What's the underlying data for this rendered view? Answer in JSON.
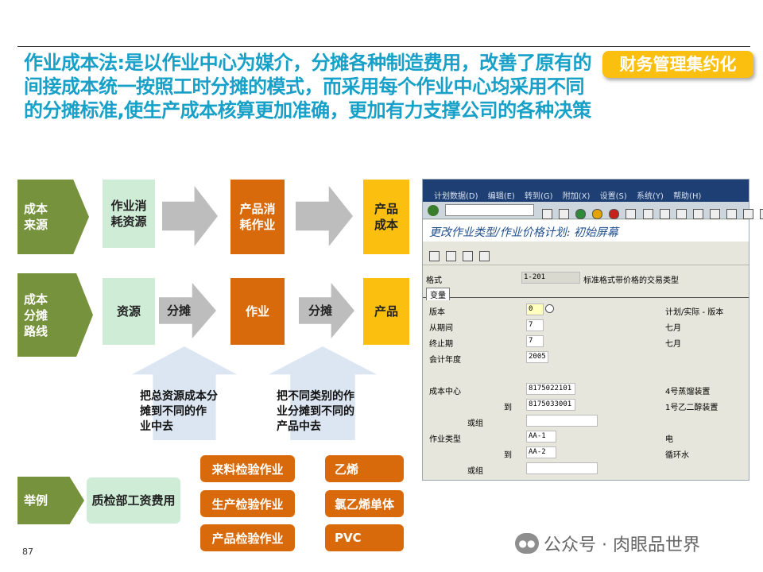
{
  "title": "作业成本法:是以作业中心为媒介，分摊各种制造费用，改善了原有的间接成本统一按照工时分摊的模式，而采用每个作业中心均采用不同的分摊标准,使生产成本核算更加准确，更加有力支撑公司的各种决策",
  "badge": "财务管理集约化",
  "row1": {
    "chevron": "成本\n来源",
    "box1": "作业消\n耗资源",
    "box2": "产品消\n耗作业",
    "box3": "产品\n成本"
  },
  "row2": {
    "chevron": "成本\n分摊\n路线",
    "box1": "资源",
    "arrow1": "分摊",
    "box2": "作业",
    "arrow2": "分摊",
    "box3": "产品"
  },
  "notes": {
    "left": "把总资源成本分\n摊到不同的作\n业中去",
    "right": "把不同类别的作\n业分摊到不同的\n产品中去"
  },
  "example": {
    "chevron": "举例",
    "source": "质检部工资费用",
    "activities": [
      "来料检验作业",
      "生产检验作业",
      "产品检验作业"
    ],
    "products": [
      "乙烯",
      "氯乙烯单体",
      "PVC"
    ]
  },
  "sap": {
    "menu": [
      "计划数据(D)",
      "编辑(E)",
      "转到(G)",
      "附加(X)",
      "设置(S)",
      "系统(Y)",
      "帮助(H)"
    ],
    "screen_title": "更改作业类型/作业价格计划: 初始屏幕",
    "layout_label": "格式",
    "layout_value": "1-201",
    "layout_desc": "标准格式带价格的交易类型",
    "tab": "变量",
    "version_label": "版本",
    "version_value": "0",
    "version_desc": "计划/实际 - 版本",
    "from_period_label": "从期间",
    "from_period_value": "7",
    "from_period_desc": "七月",
    "to_period_label": "终止期",
    "to_period_value": "7",
    "to_period_desc": "七月",
    "fiscal_year_label": "会计年度",
    "fiscal_year_value": "2005",
    "cost_center_label": "成本中心",
    "cost_center_from": "8175022101",
    "cost_center_from_desc": "4号蒸馏装置",
    "to_label": "到",
    "cost_center_to": "8175033001",
    "cost_center_to_desc": "1号乙二醇装置",
    "or_group_label": "或组",
    "activity_label": "作业类型",
    "activity_from": "AA-1",
    "activity_from_desc": "电",
    "activity_to": "AA-2",
    "activity_to_desc": "循环水"
  },
  "page_number": "87",
  "watermark": "公众号 · 肉眼品世界"
}
